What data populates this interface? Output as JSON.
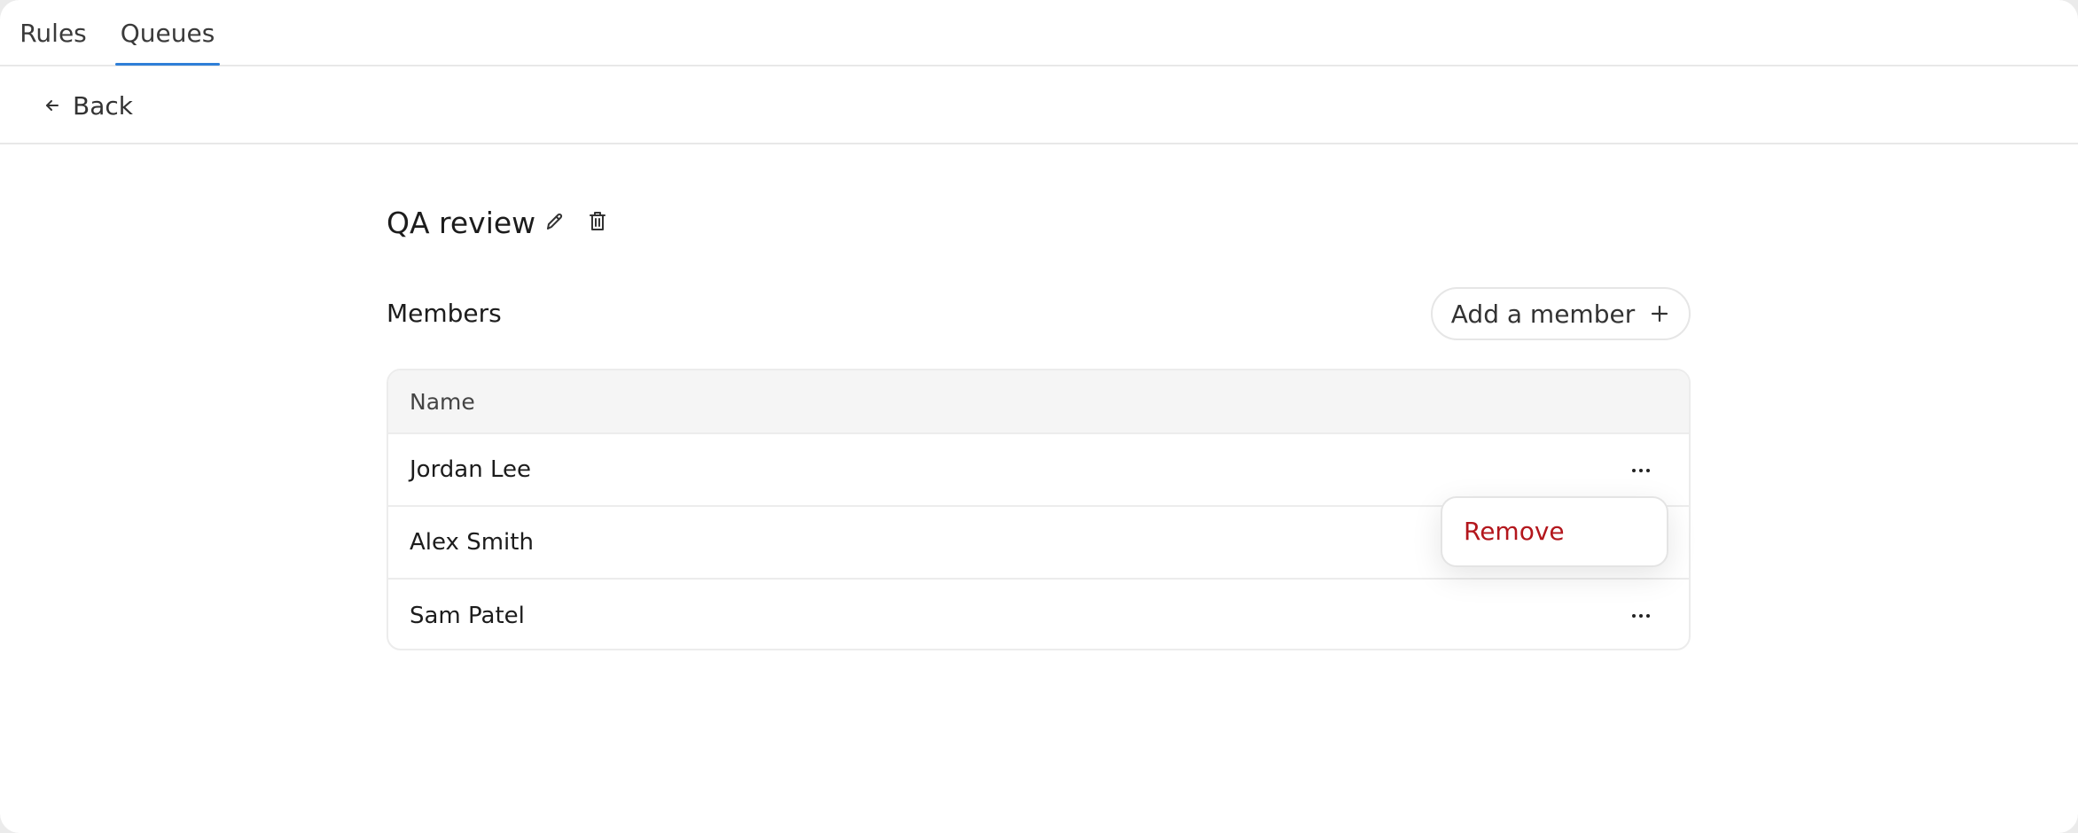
{
  "tabs": [
    {
      "label": "Rules",
      "active": false
    },
    {
      "label": "Queues",
      "active": true
    }
  ],
  "nav": {
    "back_label": "Back",
    "back_icon": "arrow-left-icon"
  },
  "queue": {
    "title": "QA review",
    "edit_icon": "pencil-icon",
    "delete_icon": "trash-icon"
  },
  "members": {
    "heading": "Members",
    "add_button_label": "Add a member",
    "add_button_icon": "plus-icon",
    "table": {
      "columns": [
        "Name"
      ],
      "rows": [
        {
          "name": "Jordan Lee"
        },
        {
          "name": "Alex Smith"
        },
        {
          "name": "Sam Patel"
        }
      ]
    }
  },
  "row_menu": {
    "items": [
      {
        "label": "Remove",
        "color": "#b3161c"
      }
    ]
  },
  "colors": {
    "accent": "#2f7fd8",
    "danger": "#b3161c",
    "table_header_bg": "#f5f5f5"
  }
}
